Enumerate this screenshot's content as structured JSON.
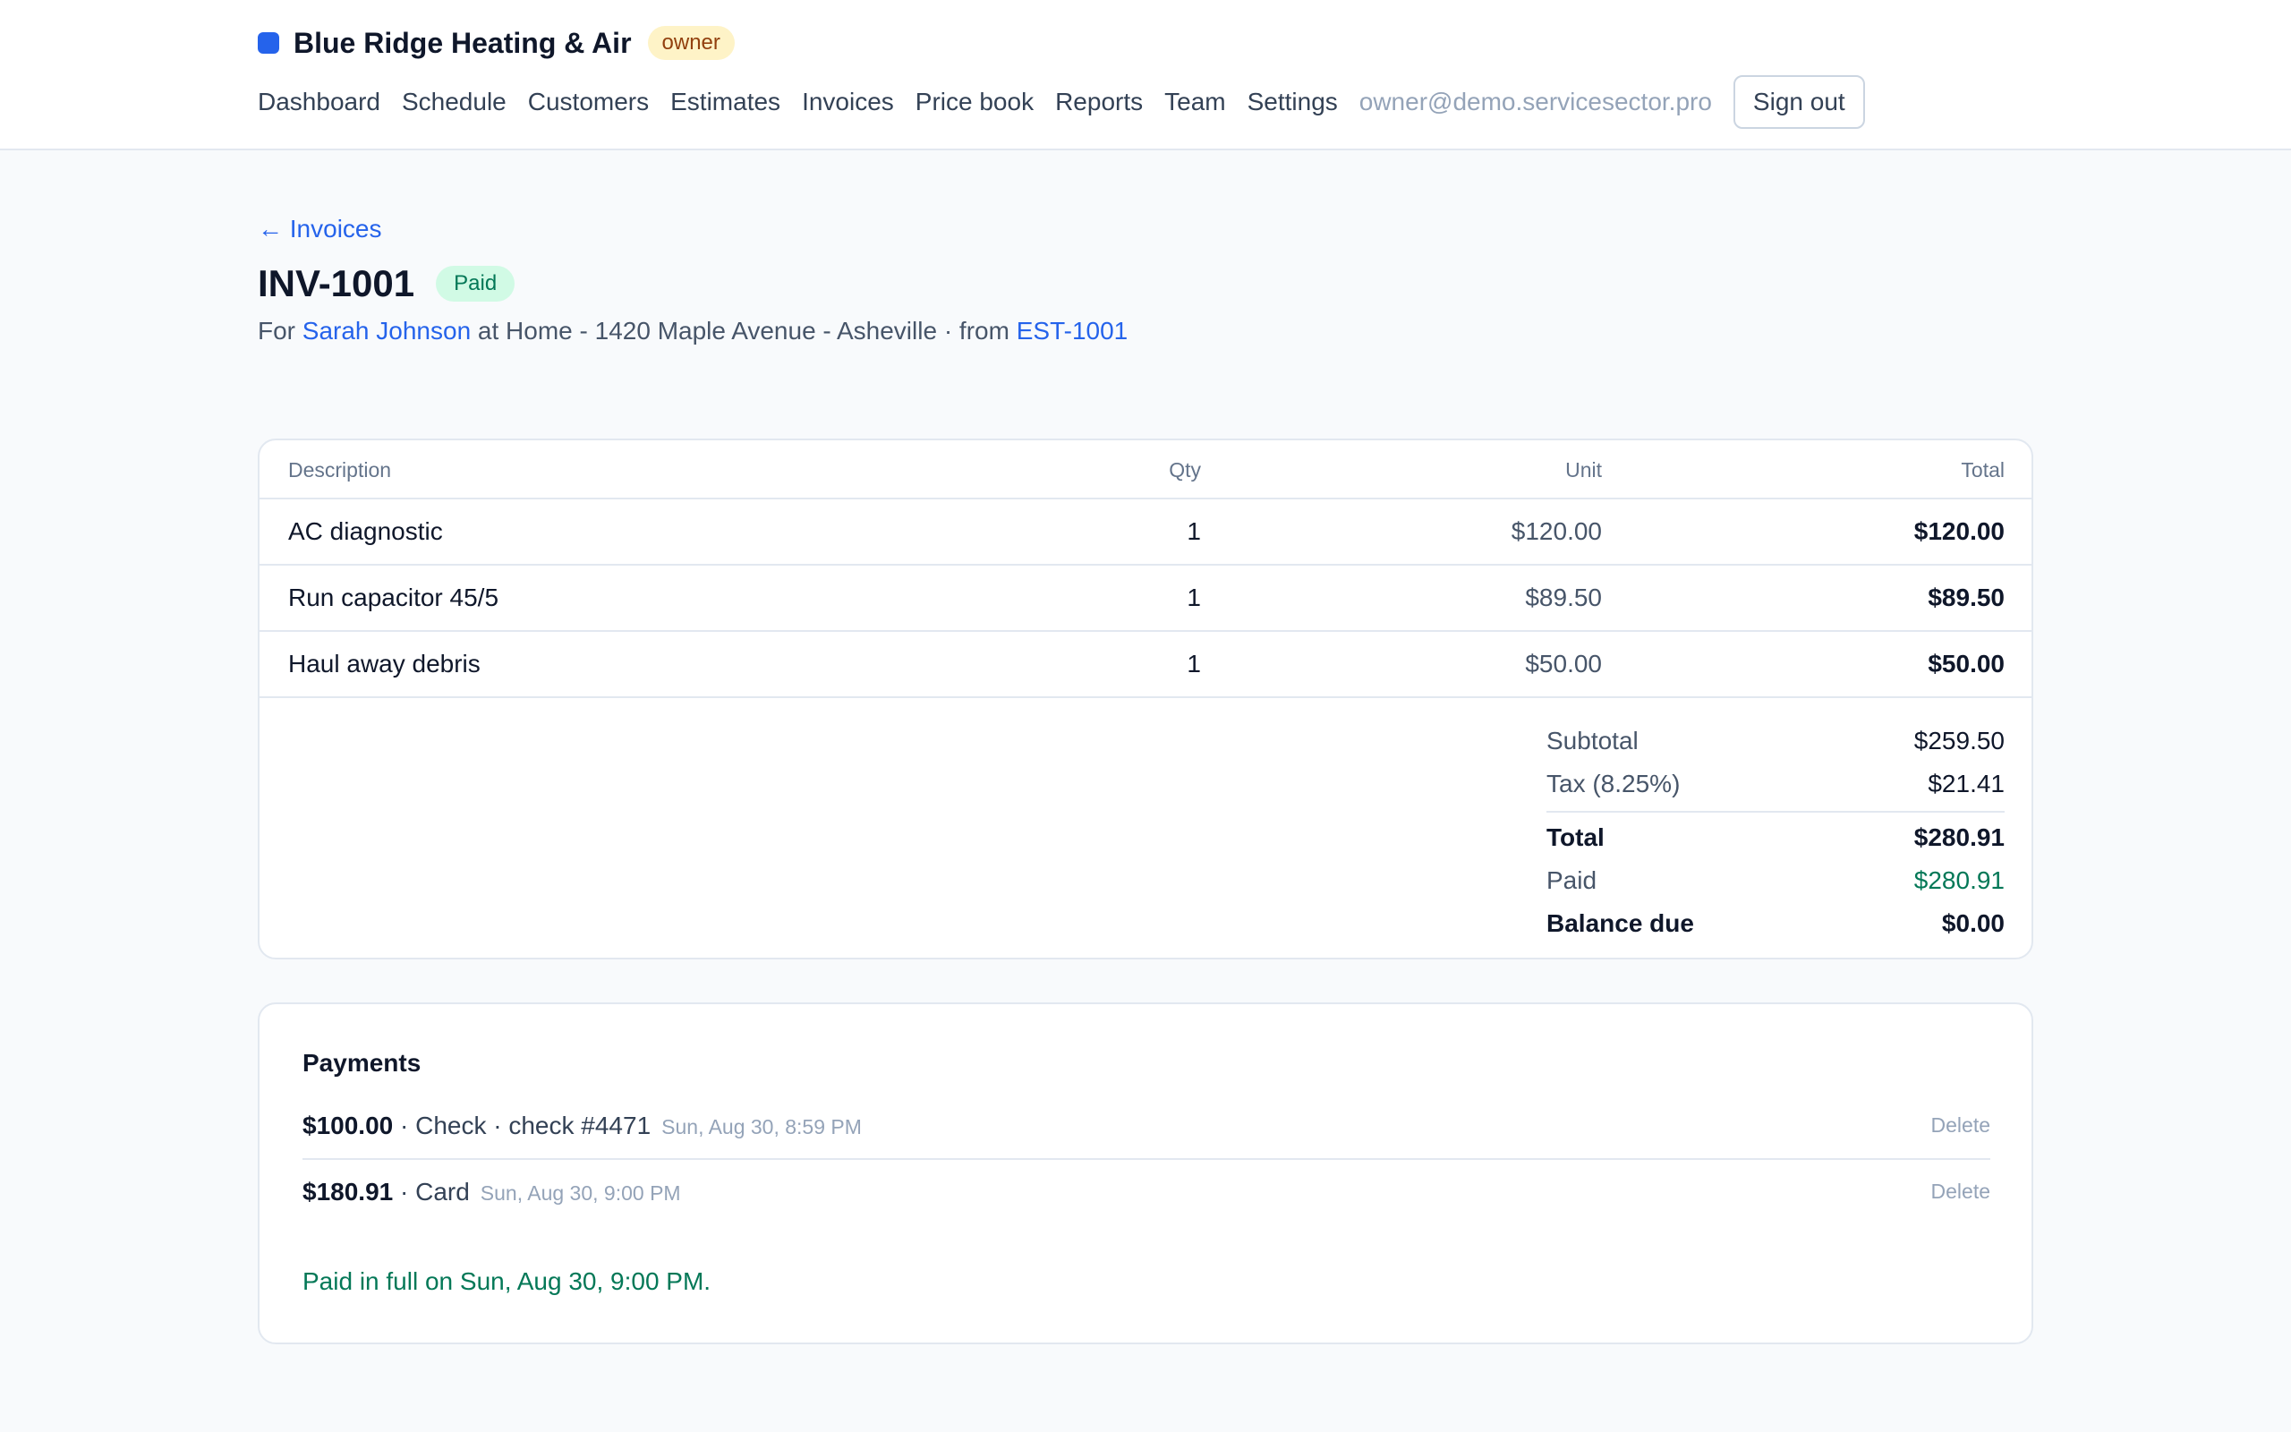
{
  "header": {
    "brand": "Blue Ridge Heating & Air",
    "role_badge": "owner",
    "nav": [
      "Dashboard",
      "Schedule",
      "Customers",
      "Estimates",
      "Invoices",
      "Price book",
      "Reports",
      "Team",
      "Settings"
    ],
    "user_email": "owner@demo.servicesector.pro",
    "sign_out": "Sign out"
  },
  "page": {
    "back_link": "← Invoices",
    "invoice_number": "INV-1001",
    "status": "Paid",
    "sub_prefix": "For",
    "customer": "Sarah Johnson",
    "location": "at Home - 1420 Maple Avenue - Asheville · from",
    "estimate": "EST-1001"
  },
  "items_table": {
    "headers": {
      "description": "Description",
      "qty": "Qty",
      "unit": "Unit",
      "total": "Total"
    },
    "rows": [
      {
        "description": "AC diagnostic",
        "qty": "1",
        "unit": "$120.00",
        "total": "$120.00"
      },
      {
        "description": "Run capacitor 45/5",
        "qty": "1",
        "unit": "$89.50",
        "total": "$89.50"
      },
      {
        "description": "Haul away debris",
        "qty": "1",
        "unit": "$50.00",
        "total": "$50.00"
      }
    ]
  },
  "totals": {
    "subtotal_label": "Subtotal",
    "subtotal": "$259.50",
    "tax_label": "Tax (8.25%)",
    "tax": "$21.41",
    "total_label": "Total",
    "total": "$280.91",
    "paid_label": "Paid",
    "paid": "$280.91",
    "balance_label": "Balance due",
    "balance": "$0.00"
  },
  "payments": {
    "heading": "Payments",
    "items": [
      {
        "amount": "$100.00",
        "details": " · Check · check #4471",
        "date": "Sun, Aug 30, 8:59 PM",
        "delete": "Delete"
      },
      {
        "amount": "$180.91",
        "details": " · Card",
        "date": "Sun, Aug 30, 9:00 PM",
        "delete": "Delete"
      }
    ],
    "paid_note": "Paid in full on Sun, Aug 30, 9:00 PM."
  },
  "colors": {
    "accent": "#2563eb",
    "success": "#047857",
    "badge_owner_bg": "#fef3c7",
    "badge_paid_bg": "#d1fae5"
  }
}
